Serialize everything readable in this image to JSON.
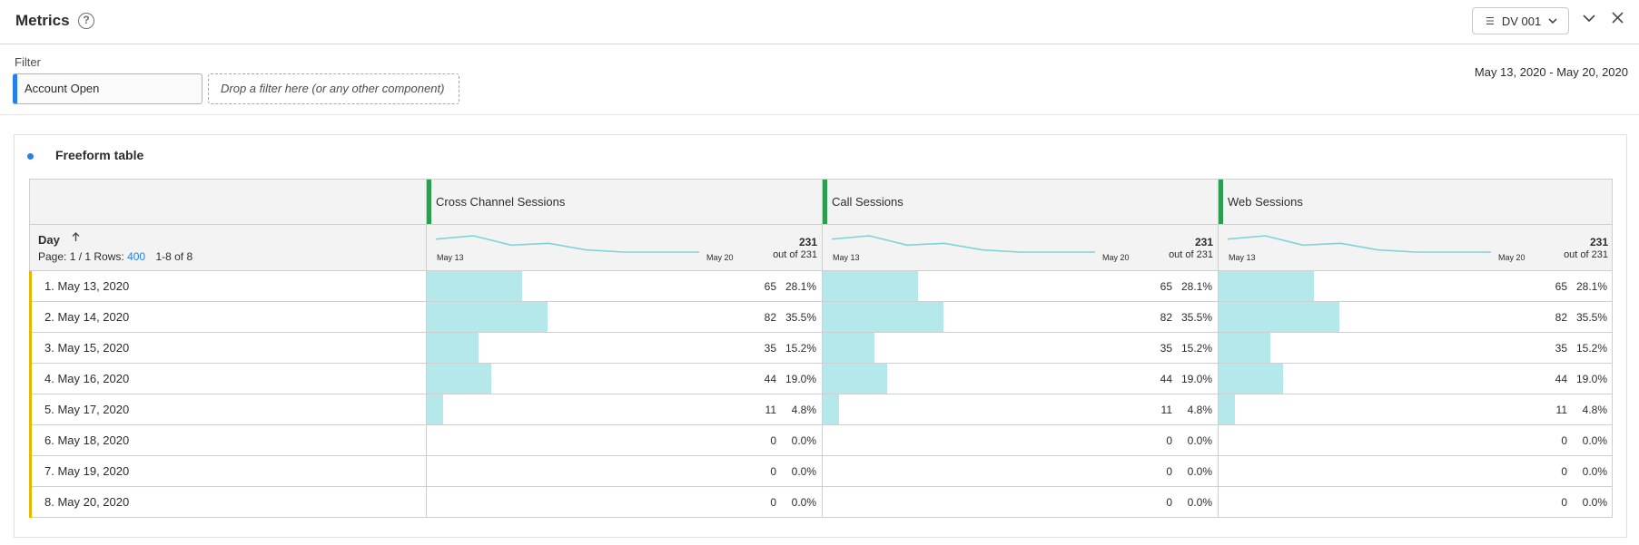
{
  "header": {
    "title": "Metrics",
    "help_symbol": "?",
    "dataview_label": "DV 001"
  },
  "filter": {
    "label": "Filter",
    "chip_label": "Account Open",
    "drop_placeholder": "Drop a filter here (or any other component)",
    "date_range": "May 13, 2020 - May 20, 2020"
  },
  "panel": {
    "title": "Freeform table"
  },
  "table": {
    "dimension": "Day",
    "page_info_prefix": "Page: 1 / 1  Rows:",
    "rows_per_page": "400",
    "range_info": "1-8 of 8",
    "metrics": [
      {
        "name": "Cross Channel Sessions",
        "total": "231",
        "out_of": "out of 231",
        "spark_from": "May 13",
        "spark_to": "May 20"
      },
      {
        "name": "Call Sessions",
        "total": "231",
        "out_of": "out of 231",
        "spark_from": "May 13",
        "spark_to": "May 20"
      },
      {
        "name": "Web Sessions",
        "total": "231",
        "out_of": "out of 231",
        "spark_from": "May 13",
        "spark_to": "May 20"
      }
    ],
    "rows": [
      {
        "label": "1. May 13, 2020",
        "value": 65,
        "pct": "28.1%",
        "fraction": 0.281
      },
      {
        "label": "2. May 14, 2020",
        "value": 82,
        "pct": "35.5%",
        "fraction": 0.355
      },
      {
        "label": "3. May 15, 2020",
        "value": 35,
        "pct": "15.2%",
        "fraction": 0.152
      },
      {
        "label": "4. May 16, 2020",
        "value": 44,
        "pct": "19.0%",
        "fraction": 0.19
      },
      {
        "label": "5. May 17, 2020",
        "value": 11,
        "pct": "4.8%",
        "fraction": 0.048
      },
      {
        "label": "6. May 18, 2020",
        "value": 0,
        "pct": "0.0%",
        "fraction": 0
      },
      {
        "label": "7. May 19, 2020",
        "value": 0,
        "pct": "0.0%",
        "fraction": 0
      },
      {
        "label": "8. May 20, 2020",
        "value": 0,
        "pct": "0.0%",
        "fraction": 0
      }
    ]
  },
  "colors": {
    "accent": "#2680eb",
    "metric_grip": "#2d9d4f",
    "row_accent": "#e6b800",
    "bar_fill": "#b4e8ea",
    "sparkline": "#7fd3d8"
  },
  "icons": {
    "help": "help-circle-icon",
    "database": "database-icon",
    "chevron_down": "chevron-down-icon",
    "collapse": "collapse-icon",
    "close": "close-icon",
    "sort_asc": "sort-ascending-icon"
  }
}
